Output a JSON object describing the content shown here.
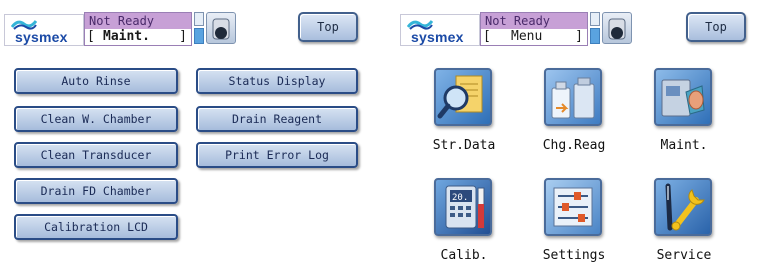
{
  "left_screen": {
    "logo": "sysmex",
    "status_line": "Not Ready",
    "mode": "Maint.",
    "top_button": "Top",
    "buttons": [
      "Auto Rinse",
      "Status Display",
      "Clean W. Chamber",
      "Drain Reagent",
      "Clean Transducer",
      "Print Error Log",
      "Drain FD Chamber",
      "Calibration LCD"
    ]
  },
  "right_screen": {
    "logo": "sysmex",
    "status_line": "Not Ready",
    "mode": "Menu",
    "top_button": "Top",
    "menu_items": [
      {
        "label": "Str.Data",
        "icon": "search-data-icon"
      },
      {
        "label": "Chg.Reag",
        "icon": "reagent-bottles-icon"
      },
      {
        "label": "Maint.",
        "icon": "maintenance-icon"
      },
      {
        "label": "Calib.",
        "icon": "calibration-icon"
      },
      {
        "label": "Settings",
        "icon": "sliders-icon"
      },
      {
        "label": "Service",
        "icon": "wrench-screwdriver-icon"
      }
    ]
  },
  "colors": {
    "status_purple": "#c7a0d6",
    "button_border": "#2a4c86",
    "logo_blue": "#1b4aa6"
  }
}
